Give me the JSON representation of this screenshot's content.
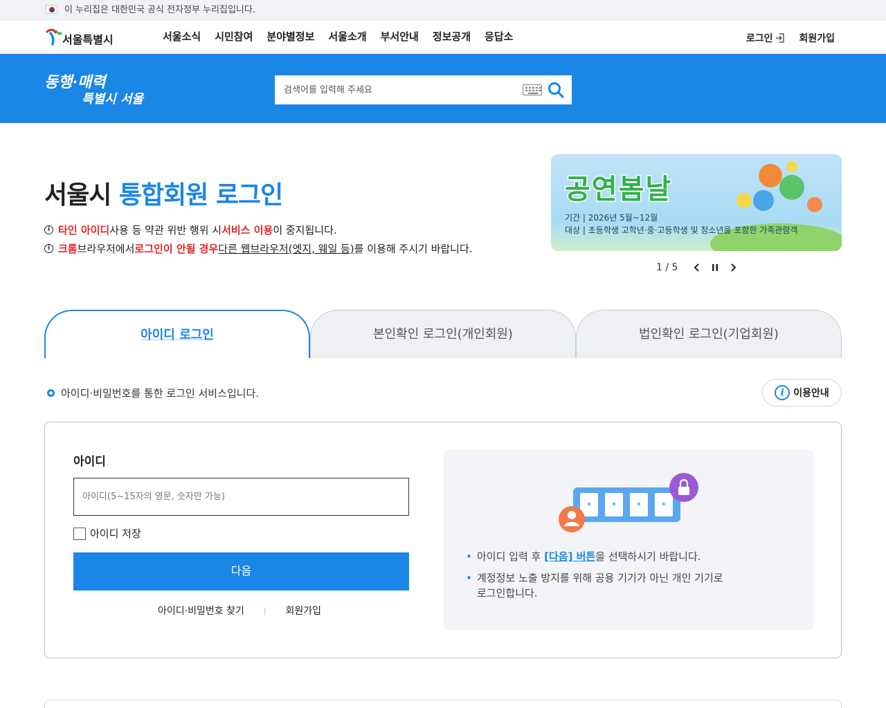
{
  "gov_banner": {
    "text": "이 누리집은 대한민국 공식 전자정부 누리집입니다."
  },
  "header": {
    "logo_text": "서울특별시",
    "nav": [
      "서울소식",
      "시민참여",
      "분야별정보",
      "서울소개",
      "부서안내",
      "정보공개",
      "응답소"
    ],
    "login_label": "로그인",
    "signup_label": "회원가입"
  },
  "banner": {
    "slogan_line1": "동행·매력",
    "slogan_line2": "특별시 서울",
    "search_placeholder": "검색어를 입력해 주세요"
  },
  "title": {
    "prefix": "서울시",
    "highlight": "통합회원 로그인"
  },
  "notices": {
    "n1": {
      "a": "타인 아이디",
      "b": " 사용 등 약관 위반 행위 시 ",
      "c": "서비스 이용",
      "d": "이 중지됩니다."
    },
    "n2": {
      "a": "크롬",
      "b": " 브라우저에서 ",
      "c": "로그인이 안될 경우",
      "d": " ",
      "e": "다른 웹브라우저(엣지, 웨일 등)",
      "f": "를 이용해 주시기 바랍니다."
    }
  },
  "promo": {
    "title": "공연봄날",
    "line1": "기간  |  2026년 5월~12월",
    "line2": "대상  |  초등학생 고학년·중·고등학생 및 청소년을 포함한 가족관람객",
    "counter": "1 / 5"
  },
  "tabs": [
    "아이디 로그인",
    "본인확인 로그인(개인회원)",
    "법인확인 로그인(기업회원)"
  ],
  "service_desc": "아이디·비밀번호를 통한 로그인 서비스입니다.",
  "guide_label": "이용안내",
  "form": {
    "id_label": "아이디",
    "id_placeholder": "아이디(5~15자의 영문, 숫자만 가능)",
    "save_id": "아이디 저장",
    "next": "다음",
    "find_link": "아이디·비밀번호 찾기",
    "signup_link": "회원가입"
  },
  "tips": {
    "t1_a": "아이디 입력 후 ",
    "t1_link": "[다음] 버튼",
    "t1_b": "을 선택하시기 바랍니다.",
    "t2_l1": "계정정보 노출 방지를 위해 공용 기기가 아닌 개인 기기로",
    "t2_l2": "로그인합니다."
  },
  "colors": {
    "primary": "#1a86e6",
    "alert": "#e1262c"
  }
}
